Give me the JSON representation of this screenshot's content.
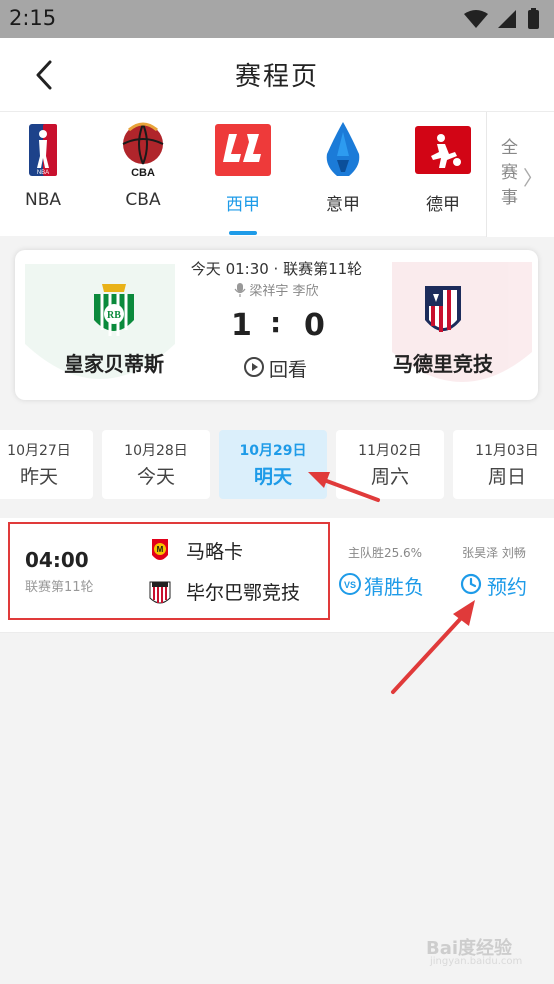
{
  "status_bar": {
    "time": "2:15"
  },
  "header": {
    "title": "赛程页"
  },
  "leagues": [
    {
      "name": "NBA",
      "active": false
    },
    {
      "name": "CBA",
      "active": false
    },
    {
      "name": "西甲",
      "active": true
    },
    {
      "name": "意甲",
      "active": false
    },
    {
      "name": "德甲",
      "active": false
    }
  ],
  "more_leagues": {
    "line1": "全",
    "line2": "赛",
    "line3": "事",
    "chevron": "〉"
  },
  "featured_match": {
    "info": "今天 01:30 · 联赛第11轮",
    "commentators": "梁祥宇 李欣",
    "home_team": "皇家贝蒂斯",
    "away_team": "马德里竞技",
    "home_score": "1",
    "separator": ":",
    "away_score": "0",
    "replay_label": "回看"
  },
  "dates": [
    {
      "date": "10月27日",
      "weekday": "昨天",
      "active": false
    },
    {
      "date": "10月28日",
      "weekday": "今天",
      "active": false
    },
    {
      "date": "10月29日",
      "weekday": "明天",
      "active": true
    },
    {
      "date": "11月02日",
      "weekday": "周六",
      "active": false
    },
    {
      "date": "11月03日",
      "weekday": "周日",
      "active": false
    }
  ],
  "fixture": {
    "time": "04:00",
    "round": "联赛第11轮",
    "home_team": "马略卡",
    "away_team": "毕尔巴鄂竞技",
    "probability": "主队胜25.6%",
    "guess_label": "猜胜负",
    "casters": "张昊泽 刘畅",
    "reserve_label": "预约"
  },
  "colors": {
    "accent": "#1e9be8",
    "annotation": "#e03a3a"
  },
  "watermark": {
    "brand": "Bai度经验",
    "sub": "jingyan.baidu.com"
  }
}
